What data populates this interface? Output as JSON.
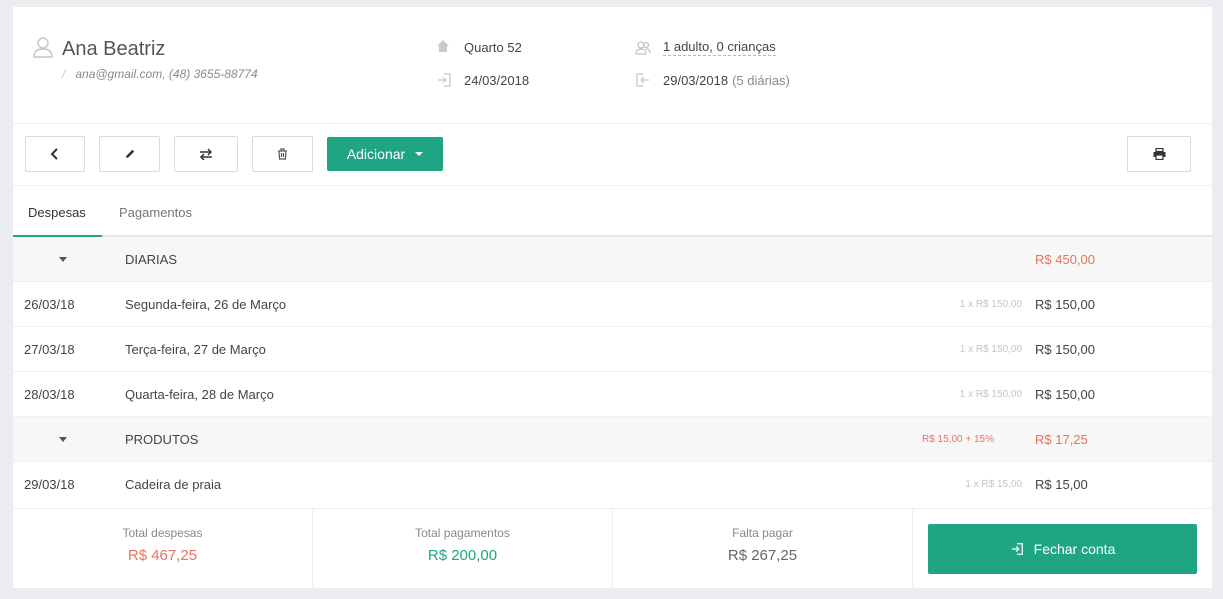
{
  "guest": {
    "name": "Ana Beatriz",
    "contact_sep": "/",
    "contact": "ana@gmail.com, (48) 3655-88774",
    "icon": "user-icon"
  },
  "stay": {
    "room": "Quarto 52",
    "guests": "1 adulto, 0 crianças",
    "checkin": "24/03/2018",
    "checkout": "29/03/2018",
    "nights": "(5 diárias)"
  },
  "toolbar": {
    "back_icon": "chevron-left-icon",
    "edit_icon": "pencil-icon",
    "transfer_icon": "swap-icon",
    "delete_icon": "trash-icon",
    "add_label": "Adicionar",
    "print_icon": "printer-icon"
  },
  "tabs": [
    {
      "label": "Despesas",
      "active": true
    },
    {
      "label": "Pagamentos",
      "active": false
    }
  ],
  "groups": {
    "diarias": {
      "title": "DIARIAS",
      "total": "R$ 450,00",
      "items": [
        {
          "date": "26/03/18",
          "desc": "Segunda-feira, 26 de Março",
          "qty": "1 x R$ 150,00",
          "amount": "R$ 150,00"
        },
        {
          "date": "27/03/18",
          "desc": "Terça-feira, 27 de Março",
          "qty": "1 x R$ 150,00",
          "amount": "R$ 150,00"
        },
        {
          "date": "28/03/18",
          "desc": "Quarta-feira, 28 de Março",
          "qty": "1 x R$ 150,00",
          "amount": "R$ 150,00"
        }
      ]
    },
    "produtos": {
      "title": "PRODUTOS",
      "fee": "R$ 15,00 + 15%",
      "total": "R$ 17,25",
      "items": [
        {
          "date": "29/03/18",
          "desc": "Cadeira de praia",
          "qty": "1 x R$ 15,00",
          "amount": "R$ 15,00"
        }
      ]
    }
  },
  "footer": {
    "total_expenses_label": "Total despesas",
    "total_expenses": "R$ 467,25",
    "total_payments_label": "Total pagamentos",
    "total_payments": "R$ 200,00",
    "remaining_label": "Falta pagar",
    "remaining": "R$ 267,25",
    "close_label": "Fechar conta"
  },
  "colors": {
    "accent": "#1fa584",
    "negative": "#e8735f"
  }
}
